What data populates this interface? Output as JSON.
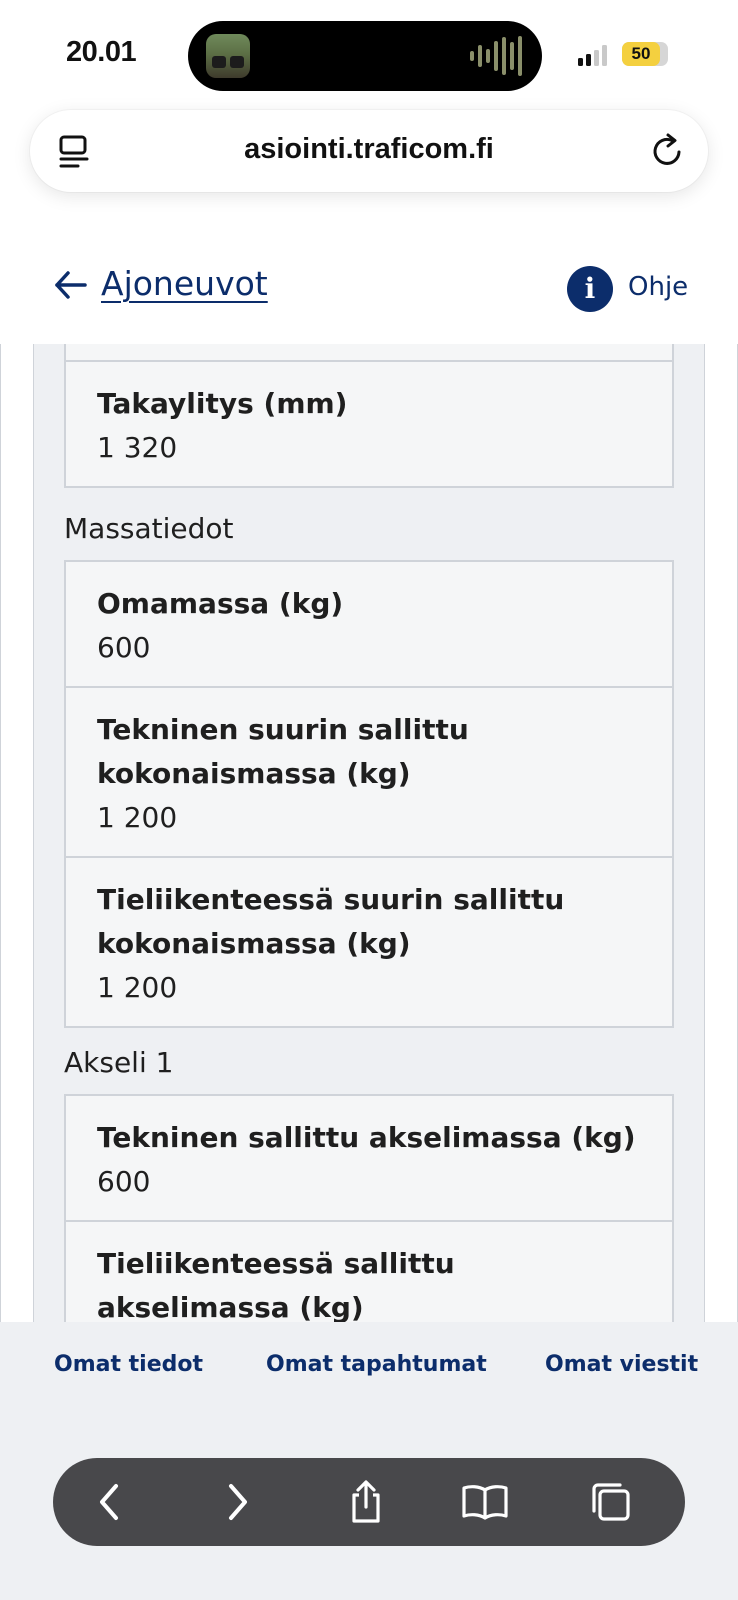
{
  "status_bar": {
    "time": "20.01",
    "battery_level": "50",
    "signal_bars_active": 2,
    "signal_bars_total": 4
  },
  "browser": {
    "url": "asiointi.traficom.fi"
  },
  "header": {
    "back_label": "Ajoneuvot",
    "help_label": "Ohje",
    "info_glyph": "i"
  },
  "sections": {
    "dimensions_tail": {
      "rows": [
        {
          "label": "Takaylitys (mm)",
          "value": "1 320"
        }
      ]
    },
    "mass": {
      "title": "Massatiedot",
      "rows": [
        {
          "label": "Omamassa (kg)",
          "value": "600"
        },
        {
          "label": "Tekninen suurin sallittu kokonaismassa (kg)",
          "value": "1 200"
        },
        {
          "label": "Tieliikenteessä suurin sallittu kokonaismassa (kg)",
          "value": "1 200"
        }
      ]
    },
    "axle1": {
      "title": "Akseli 1",
      "rows": [
        {
          "label": "Tekninen sallittu akselimassa (kg)",
          "value": "600"
        },
        {
          "label": "Tieliikenteessä sallittu akselimassa (kg)",
          "value": ""
        }
      ]
    }
  },
  "bottom_nav": {
    "items": [
      "Omat tiedot",
      "Omat tapahtumat",
      "Omat viestit"
    ]
  },
  "toolbar": {
    "icons": [
      "back-icon",
      "forward-icon",
      "share-icon",
      "bookmarks-icon",
      "tabs-icon"
    ]
  },
  "colors": {
    "link": "#0c2d6b",
    "panel_background": "#eef0f3",
    "card_background": "#f5f6f7",
    "card_border": "#cfd3d9",
    "battery": "#f4d03f",
    "toolbar": "#48484b"
  }
}
